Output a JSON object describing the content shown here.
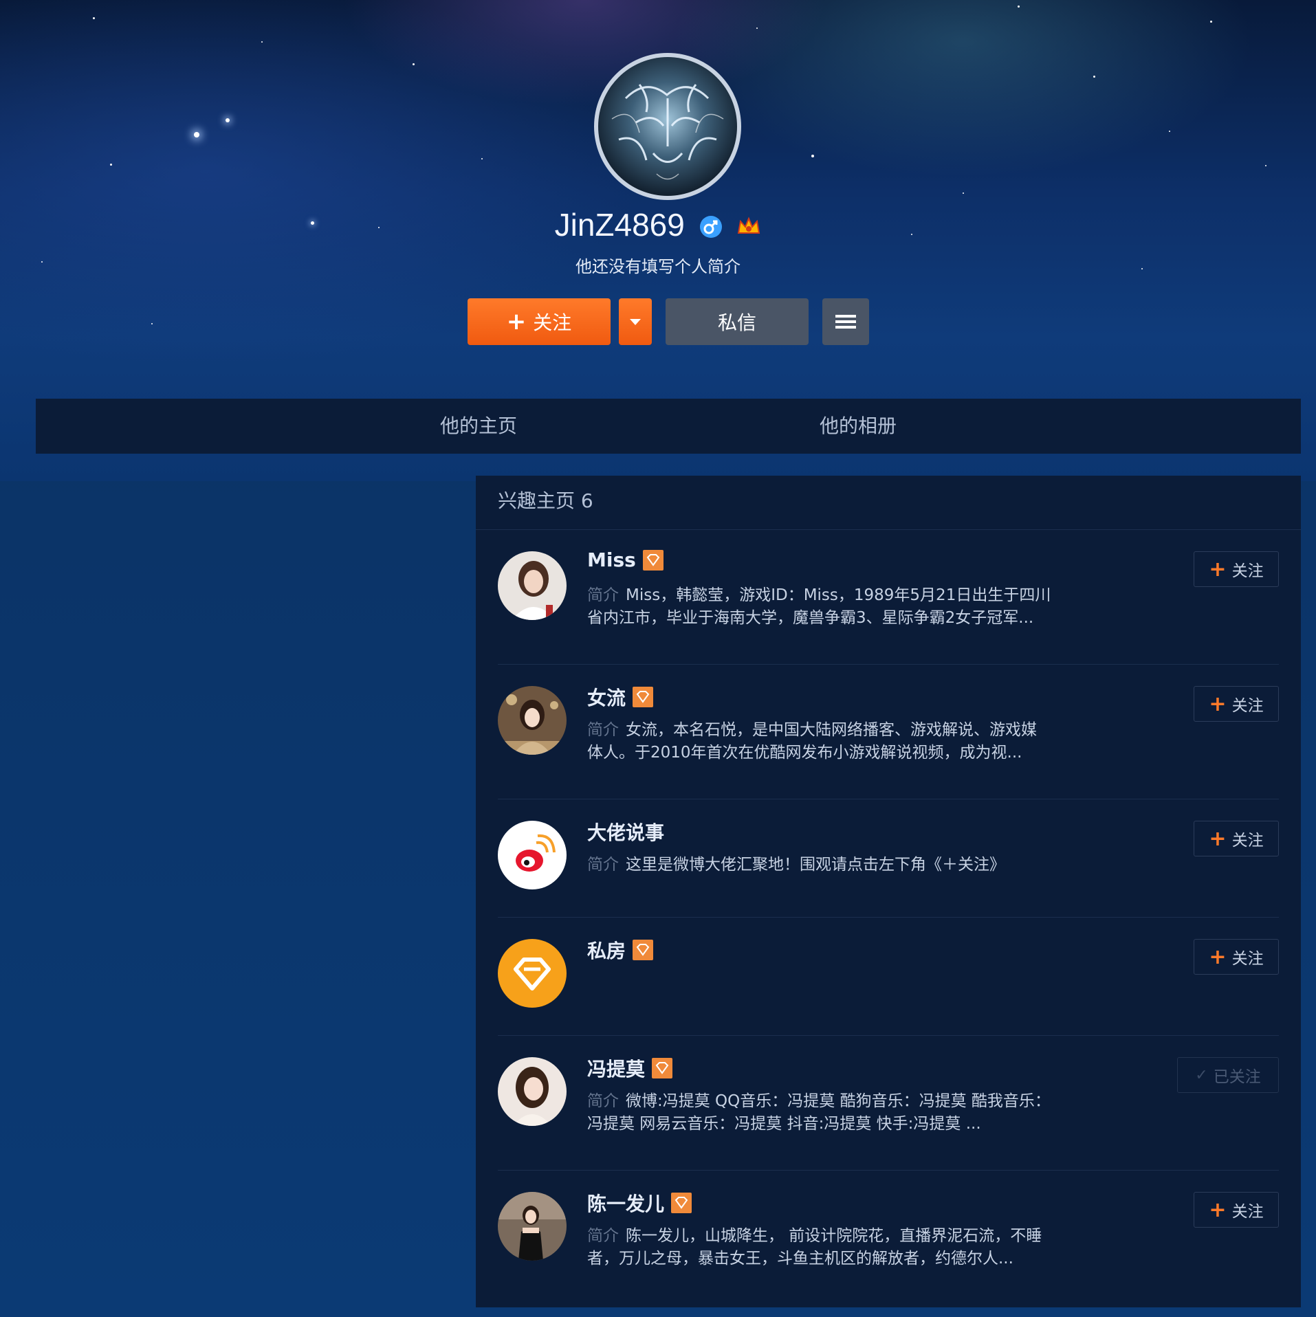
{
  "profile": {
    "username": "JinZ4869",
    "bio": "他还没有填写个人简介",
    "follow_label": "关注",
    "message_label": "私信"
  },
  "tabs": [
    {
      "label": "他的主页"
    },
    {
      "label": "他的相册"
    }
  ],
  "interests": {
    "title": "兴趣主页 6",
    "desc_label": "简介",
    "items": [
      {
        "name": "Miss",
        "desc_line1": "Miss，韩懿莹，游戏ID：Miss，1989年5月21日出生于四川",
        "desc_line2": "省内江市，毕业于海南大学，魔兽争霸3、星际争霸2女子冠军...",
        "button": "关注"
      },
      {
        "name": "女流",
        "desc_line1": "女流，本名石悦，是中国大陆网络播客、游戏解说、游戏媒",
        "desc_line2": "体人。于2010年首次在优酷网发布小游戏解说视频，成为视...",
        "button": "关注"
      },
      {
        "name": "大佬说事",
        "desc_line1": "这里是微博大佬汇聚地！围观请点击左下角《＋关注》",
        "desc_line2": "",
        "button": "关注"
      },
      {
        "name": "私房",
        "desc_line1": "",
        "desc_line2": "",
        "button": "关注"
      },
      {
        "name": "冯提莫",
        "desc_line1": "微博:冯提莫 QQ音乐：冯提莫 酷狗音乐：冯提莫 酷我音乐：",
        "desc_line2": "冯提莫 网易云音乐：冯提莫 抖音:冯提莫 快手:冯提莫 ...",
        "button": "已关注"
      },
      {
        "name": "陈一发儿",
        "desc_line1": "陈一发儿，山城降生， 前设计院院花，直播界泥石流，不睡",
        "desc_line2": "者，万儿之母，暴击女王，斗鱼主机区的解放者，约德尔人...",
        "button": "关注"
      }
    ]
  },
  "colors": {
    "accent_orange": "#f05a10",
    "panel_bg": "#0b1c38",
    "male_badge": "#3aa0ff"
  }
}
